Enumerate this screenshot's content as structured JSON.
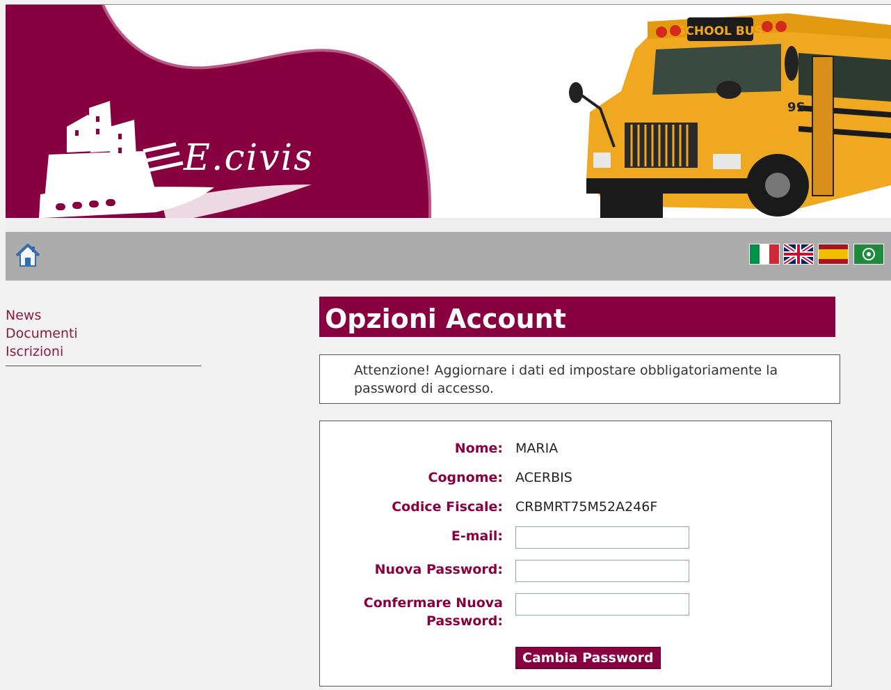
{
  "header": {
    "logo_text": "E.civis",
    "bus_label": "SCHOOL BUS",
    "bus_number": "56"
  },
  "navbar": {
    "home_icon": "home-icon",
    "languages": [
      "Italiano",
      "English",
      "Español",
      "Arabic"
    ]
  },
  "sidebar": {
    "items": [
      {
        "label": "News"
      },
      {
        "label": "Documenti"
      },
      {
        "label": "Iscrizioni"
      }
    ]
  },
  "main": {
    "title": "Opzioni Account",
    "notice": "Attenzione! Aggiornare i dati ed impostare obbligatoriamente la password di accesso.",
    "form": {
      "nome_label": "Nome:",
      "nome_value": "MARIA",
      "cognome_label": "Cognome:",
      "cognome_value": "ACERBIS",
      "cf_label": "Codice Fiscale:",
      "cf_value": "CRBMRT75M52A246F",
      "email_label": "E-mail:",
      "email_value": "",
      "new_pw_label": "Nuova Password:",
      "new_pw_value": "",
      "confirm_pw_label": "Confermare Nuova Password:",
      "confirm_pw_value": "",
      "submit_label": "Cambia Password"
    }
  },
  "colors": {
    "brand": "#88003f",
    "navbar": "#acacac",
    "background": "#f2f2f2"
  }
}
